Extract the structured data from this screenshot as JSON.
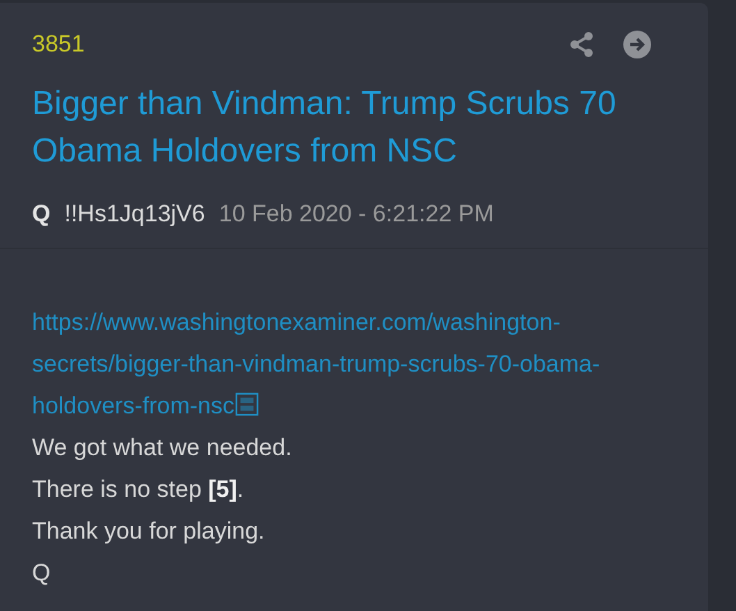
{
  "post": {
    "number": "3851",
    "title": "Bigger than Vindman: Trump Scrubs 70 Obama Holdovers from NSC",
    "author": {
      "name": "Q",
      "tripcode": "!!Hs1Jq13jV6"
    },
    "timestamp": "10 Feb 2020 - 6:21:22 PM",
    "body": [
      {
        "kind": "link",
        "text": "https://www.washingtonexaminer.com/washington-secrets/bigger-than-vindman-trump-scrubs-70-obama-holdovers-from-nsc"
      },
      {
        "kind": "text",
        "text": "We got what we needed."
      },
      {
        "kind": "text",
        "text": "There is no step **[5]**."
      },
      {
        "kind": "text",
        "text": "Thank you for playing."
      },
      {
        "kind": "text",
        "text": "Q"
      }
    ]
  }
}
